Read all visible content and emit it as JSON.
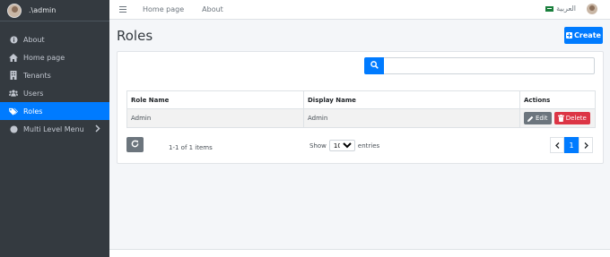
{
  "user": {
    "name": ".\\admin"
  },
  "sidebar": {
    "items": [
      {
        "label": "About",
        "icon": "info-circle-icon"
      },
      {
        "label": "Home page",
        "icon": "home-icon"
      },
      {
        "label": "Tenants",
        "icon": "building-icon"
      },
      {
        "label": "Users",
        "icon": "users-icon"
      },
      {
        "label": "Roles",
        "icon": "tags-icon",
        "active": true
      },
      {
        "label": "Multi Level Menu",
        "icon": "circle-icon",
        "has_submenu": true
      }
    ]
  },
  "topbar": {
    "links": [
      "Home page",
      "About"
    ],
    "language": "العربية"
  },
  "page": {
    "title": "Roles",
    "create_label": "Create"
  },
  "table": {
    "headers": [
      "Role Name",
      "Display Name",
      "Actions"
    ],
    "rows": [
      {
        "role_name": "Admin",
        "display_name": "Admin"
      }
    ],
    "edit_label": "Edit",
    "delete_label": "Delete"
  },
  "footer_bar": {
    "count_text": "1-1 of 1 items",
    "show_label": "Show",
    "page_size": "10",
    "entries_label": "entries",
    "current_page": "1"
  },
  "colors": {
    "primary": "#007bff",
    "danger": "#dc3545",
    "secondary": "#6c757d",
    "sidebar": "#343a40"
  }
}
